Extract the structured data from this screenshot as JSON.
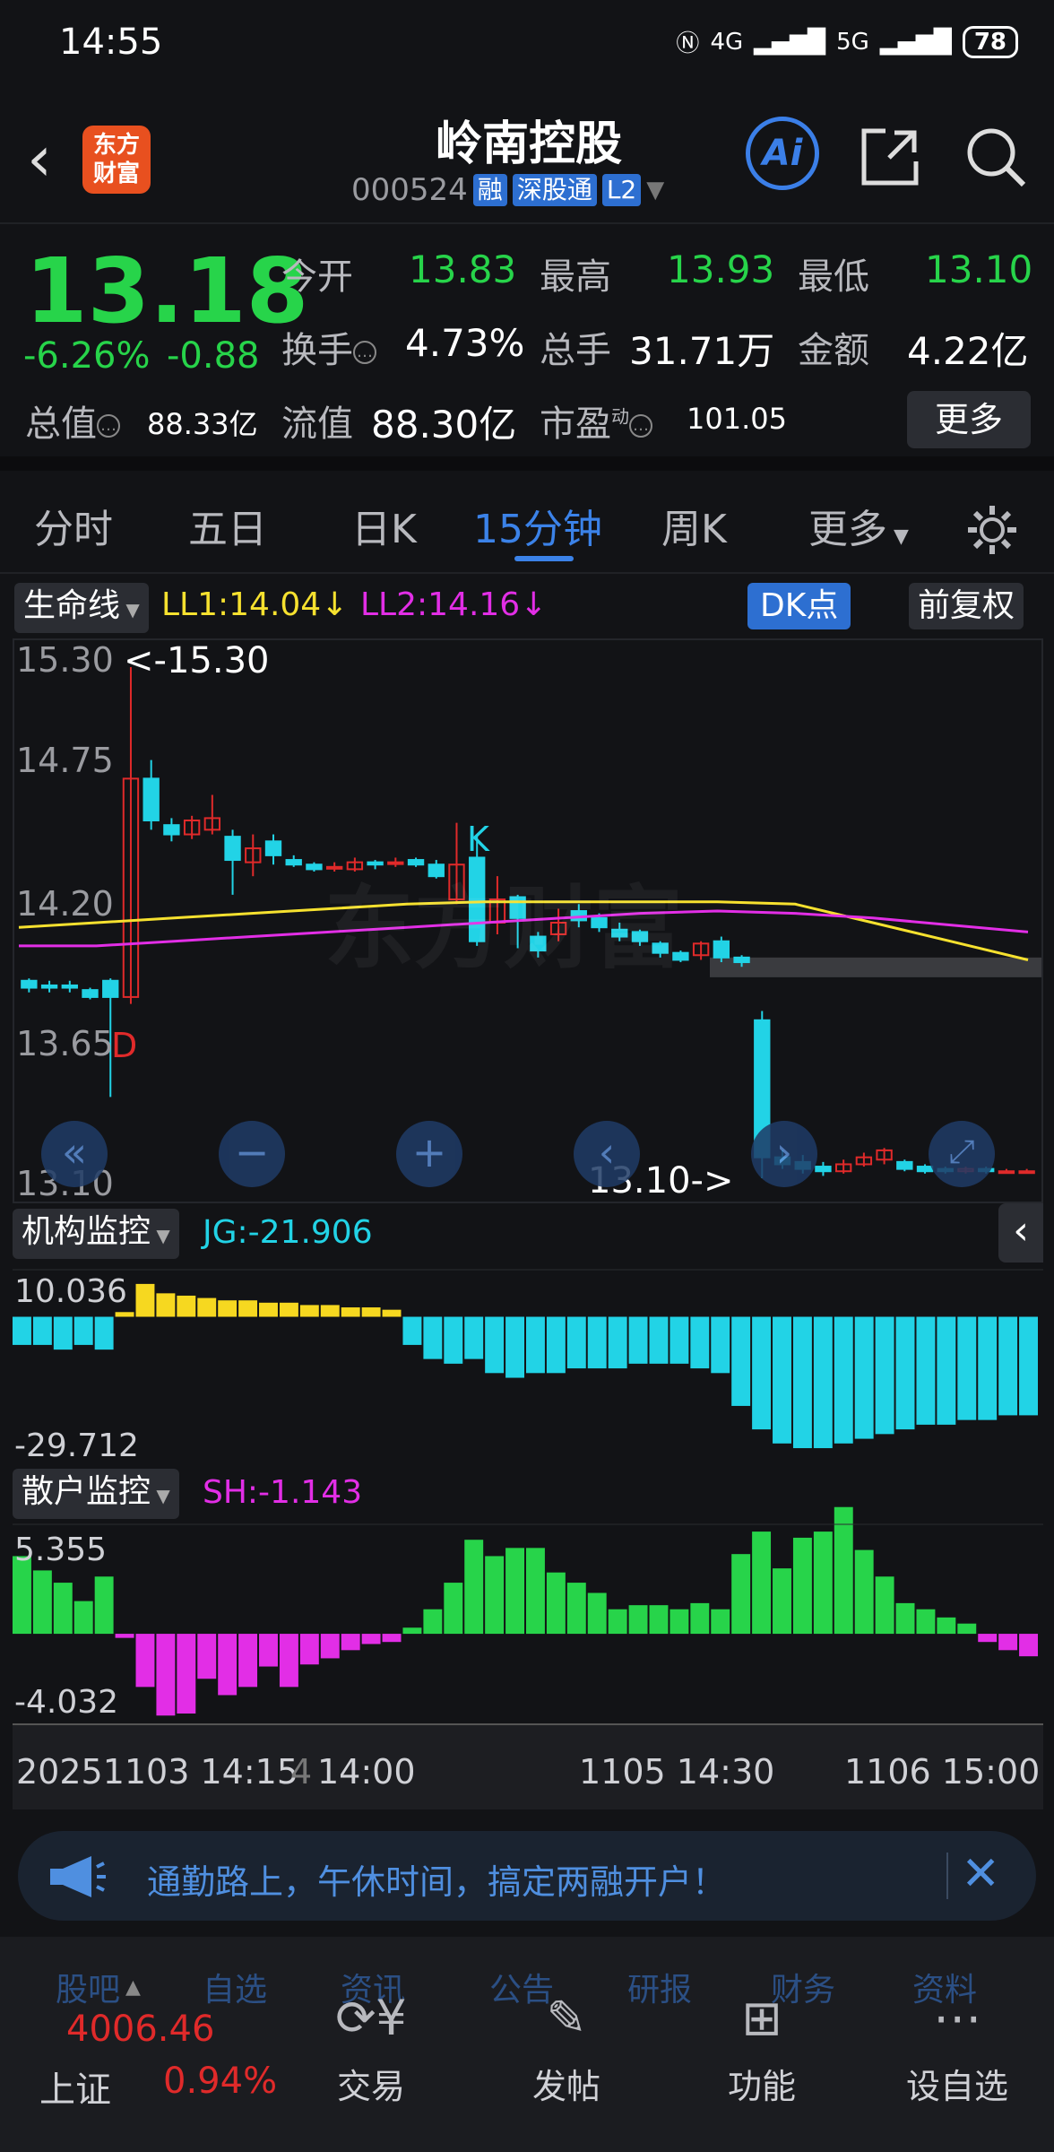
{
  "status_bar": {
    "time": "14:55",
    "net1": "4G",
    "net2": "5G",
    "battery": "78"
  },
  "header": {
    "logo_line1": "东方",
    "logo_line2": "财富",
    "title": "岭南控股",
    "code": "000524",
    "tag_rong": "融",
    "tag_sgt": "深股通",
    "tag_l2": "L2",
    "ai_label": "Ai"
  },
  "quote": {
    "price": "13.18",
    "change_pct": "-6.26%",
    "change": "-0.88",
    "open_label": "今开",
    "open": "13.83",
    "high_label": "最高",
    "high": "13.93",
    "low_label": "最低",
    "low": "13.10",
    "turnover_label": "换手",
    "turnover": "4.73%",
    "volume_label": "总手",
    "volume": "31.71万",
    "amount_label": "金额",
    "amount": "4.22亿",
    "mktcap_label": "总值",
    "mktcap": "88.33亿",
    "float_label": "流值",
    "float_cap": "88.30亿",
    "pe_label": "市盈",
    "pe_sup": "动",
    "pe": "101.05",
    "more_label": "更多"
  },
  "tabs": [
    "分时",
    "五日",
    "日K",
    "15分钟",
    "周K",
    "更多"
  ],
  "active_tab": "15分钟",
  "indicator_bar": {
    "selector": "生命线",
    "ll1": "LL1:14.04↓",
    "ll2": "LL2:14.16↓",
    "dk_label": "DK点",
    "adjust_label": "前复权"
  },
  "colors": {
    "up": "#e02a2a",
    "down": "#22d3e6",
    "green": "#27d44a",
    "accent": "#3b82e8",
    "ll1": "#f6e12f",
    "ll2": "#e22ee6",
    "bg": "#121316"
  },
  "main_chart": {
    "y_ticks": [
      "15.30",
      "14.75",
      "14.20",
      "13.65",
      "13.10"
    ],
    "high_marker": "<-15.30",
    "low_marker": "13.10->",
    "k_marker": "K",
    "d_marker": "D",
    "watermark": "东方财富"
  },
  "jg_panel": {
    "selector": "机构监控",
    "value_label": "JG:-21.906",
    "max": "10.036",
    "min": "-29.712"
  },
  "sh_panel": {
    "selector": "散户监控",
    "value_label": "SH:-1.143",
    "max": "5.355",
    "min": "-4.032"
  },
  "x_axis": {
    "labels": [
      "20251103 14:15",
      "4",
      "14:00",
      "1105 14:30",
      "1106 15:00"
    ]
  },
  "chart_data": [
    {
      "type": "candlestick",
      "title": "15分钟",
      "ylim": [
        13.1,
        15.3
      ],
      "y_ticks": [
        15.3,
        14.75,
        14.2,
        13.65,
        13.1
      ],
      "series": [
        {
          "name": "LL1",
          "value_last": 14.04,
          "values": [
            14.18,
            14.2,
            14.22,
            14.24,
            14.26,
            14.28,
            14.29,
            14.29,
            14.29,
            14.29,
            14.28,
            14.2,
            14.12,
            14.04
          ]
        },
        {
          "name": "LL2",
          "value_last": 14.16,
          "values": [
            14.1,
            14.1,
            14.12,
            14.14,
            14.16,
            14.18,
            14.2,
            14.22,
            14.24,
            14.25,
            14.24,
            14.22,
            14.19,
            14.16
          ]
        }
      ],
      "candles": [
        {
          "o": 13.95,
          "c": 13.92,
          "h": 13.96,
          "l": 13.9
        },
        {
          "o": 13.93,
          "c": 13.92,
          "h": 13.95,
          "l": 13.9
        },
        {
          "o": 13.93,
          "c": 13.92,
          "h": 13.95,
          "l": 13.9
        },
        {
          "o": 13.91,
          "c": 13.88,
          "h": 13.92,
          "l": 13.87
        },
        {
          "o": 13.95,
          "c": 13.88,
          "h": 13.96,
          "l": 13.45
        },
        {
          "o": 13.88,
          "c": 14.82,
          "h": 15.3,
          "l": 13.85
        },
        {
          "o": 14.82,
          "c": 14.64,
          "h": 14.9,
          "l": 14.6
        },
        {
          "o": 14.62,
          "c": 14.58,
          "h": 14.65,
          "l": 14.55
        },
        {
          "o": 14.58,
          "c": 14.64,
          "h": 14.66,
          "l": 14.56
        },
        {
          "o": 14.6,
          "c": 14.65,
          "h": 14.75,
          "l": 14.58
        },
        {
          "o": 14.57,
          "c": 14.47,
          "h": 14.6,
          "l": 14.32
        },
        {
          "o": 14.46,
          "c": 14.52,
          "h": 14.58,
          "l": 14.4
        },
        {
          "o": 14.55,
          "c": 14.49,
          "h": 14.58,
          "l": 14.45
        },
        {
          "o": 14.47,
          "c": 14.45,
          "h": 14.49,
          "l": 14.44
        },
        {
          "o": 14.45,
          "c": 14.43,
          "h": 14.46,
          "l": 14.42
        },
        {
          "o": 14.44,
          "c": 14.44,
          "h": 14.46,
          "l": 14.42
        },
        {
          "o": 14.43,
          "c": 14.46,
          "h": 14.48,
          "l": 14.42
        },
        {
          "o": 14.46,
          "c": 14.45,
          "h": 14.47,
          "l": 14.43
        },
        {
          "o": 14.46,
          "c": 14.46,
          "h": 14.48,
          "l": 14.44
        },
        {
          "o": 14.47,
          "c": 14.45,
          "h": 14.48,
          "l": 14.44
        },
        {
          "o": 14.45,
          "c": 14.4,
          "h": 14.47,
          "l": 14.39
        },
        {
          "o": 14.3,
          "c": 14.45,
          "h": 14.63,
          "l": 14.28
        },
        {
          "o": 14.48,
          "c": 14.12,
          "h": 14.58,
          "l": 14.1
        },
        {
          "o": 14.2,
          "c": 14.3,
          "h": 14.4,
          "l": 14.15
        },
        {
          "o": 14.31,
          "c": 14.22,
          "h": 14.32,
          "l": 14.09
        },
        {
          "o": 14.14,
          "c": 14.08,
          "h": 14.16,
          "l": 14.05
        },
        {
          "o": 14.15,
          "c": 14.2,
          "h": 14.26,
          "l": 14.12
        },
        {
          "o": 14.25,
          "c": 14.21,
          "h": 14.28,
          "l": 14.18
        },
        {
          "o": 14.22,
          "c": 14.18,
          "h": 14.24,
          "l": 14.16
        },
        {
          "o": 14.17,
          "c": 14.14,
          "h": 14.2,
          "l": 14.12
        },
        {
          "o": 14.16,
          "c": 14.12,
          "h": 14.17,
          "l": 14.1
        },
        {
          "o": 14.11,
          "c": 14.07,
          "h": 14.12,
          "l": 14.05
        },
        {
          "o": 14.07,
          "c": 14.04,
          "h": 14.08,
          "l": 14.03
        },
        {
          "o": 14.06,
          "c": 14.11,
          "h": 14.12,
          "l": 14.04
        },
        {
          "o": 14.12,
          "c": 14.05,
          "h": 14.14,
          "l": 14.03
        },
        {
          "o": 14.05,
          "c": 14.03,
          "h": 14.06,
          "l": 14.01
        },
        {
          "o": 13.78,
          "c": 13.19,
          "h": 13.82,
          "l": 13.1
        },
        {
          "o": 13.19,
          "c": 13.16,
          "h": 13.22,
          "l": 13.14
        },
        {
          "o": 13.17,
          "c": 13.14,
          "h": 13.2,
          "l": 13.12
        },
        {
          "o": 13.15,
          "c": 13.13,
          "h": 13.17,
          "l": 13.11
        },
        {
          "o": 13.13,
          "c": 13.16,
          "h": 13.18,
          "l": 13.12
        },
        {
          "o": 13.16,
          "c": 13.19,
          "h": 13.21,
          "l": 13.15
        },
        {
          "o": 13.18,
          "c": 13.22,
          "h": 13.23,
          "l": 13.16
        },
        {
          "o": 13.17,
          "c": 13.14,
          "h": 13.18,
          "l": 13.13
        },
        {
          "o": 13.15,
          "c": 13.13,
          "h": 13.16,
          "l": 13.12
        },
        {
          "o": 13.14,
          "c": 13.13,
          "h": 13.15,
          "l": 13.12
        },
        {
          "o": 13.13,
          "c": 13.14,
          "h": 13.15,
          "l": 13.12
        },
        {
          "o": 13.14,
          "c": 13.13,
          "h": 13.15,
          "l": 13.12
        },
        {
          "o": 13.13,
          "c": 13.13,
          "h": 13.14,
          "l": 13.12
        },
        {
          "o": 13.13,
          "c": 13.13,
          "h": 13.14,
          "l": 13.12
        }
      ]
    },
    {
      "type": "bar",
      "title": "机构监控",
      "ylim": [
        -29.712,
        10.036
      ],
      "values": [
        -6,
        -6,
        -7,
        -6,
        -7,
        1,
        7,
        5,
        4.5,
        4,
        3.5,
        3.5,
        3,
        3,
        2.5,
        2.5,
        2,
        2,
        1.5,
        -6,
        -9,
        -10,
        -9,
        -12,
        -13,
        -12,
        -12,
        -11,
        -11,
        -11,
        -10,
        -10,
        -10,
        -11,
        -12,
        -19,
        -24,
        -27,
        -28,
        -28,
        -27,
        -26,
        -25,
        -24,
        -23,
        -23,
        -22,
        -22,
        -21,
        -21
      ]
    },
    {
      "type": "bar",
      "title": "散户监控",
      "ylim": [
        -4.032,
        5.355
      ],
      "values": [
        3.8,
        3.1,
        2.5,
        1.6,
        2.8,
        -0.2,
        -2.6,
        -4.0,
        -3.9,
        -2.2,
        -3.0,
        -2.6,
        -1.6,
        -2.6,
        -1.5,
        -1.2,
        -0.8,
        -0.5,
        -0.4,
        0.3,
        1.2,
        2.5,
        4.6,
        3.8,
        4.2,
        4.2,
        3.0,
        2.5,
        2.0,
        1.2,
        1.4,
        1.4,
        1.2,
        1.5,
        1.2,
        3.9,
        5.0,
        3.2,
        4.7,
        5.0,
        6.2,
        4.1,
        2.8,
        1.5,
        1.2,
        0.8,
        0.5,
        -0.4,
        -0.8,
        -1.1
      ]
    }
  ],
  "banner": {
    "text": "通勤路上，午休时间，搞定两融开户！"
  },
  "bottom_nav": {
    "index_name": "上证",
    "index_value": "4006.46",
    "index_change": "0.94%",
    "items": [
      "交易",
      "发帖",
      "功能",
      "设自选"
    ],
    "ghost_tabs": [
      "股吧",
      "自选",
      "资讯",
      "公告",
      "研报",
      "财务",
      "资料"
    ]
  }
}
